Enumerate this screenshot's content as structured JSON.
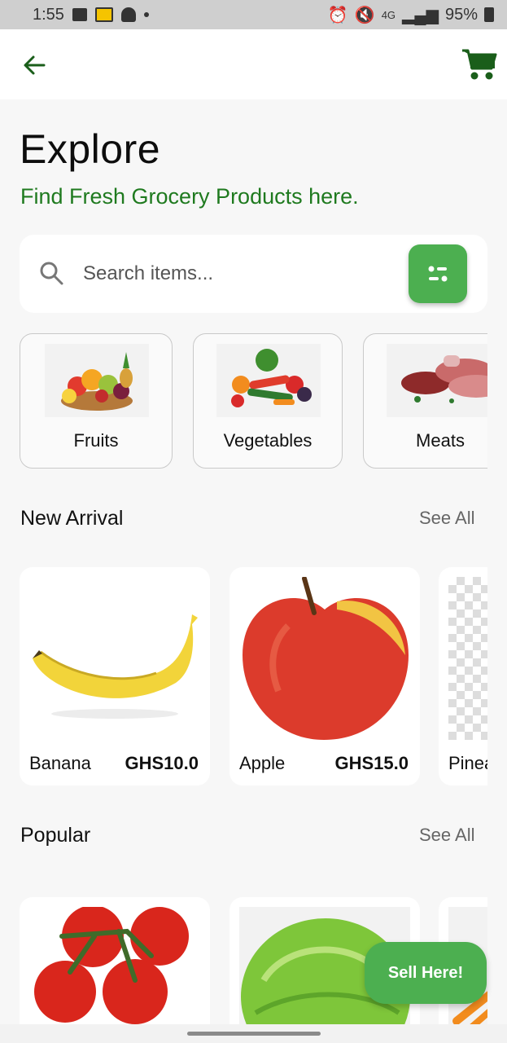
{
  "status_bar": {
    "time": "1:55",
    "network": "4G",
    "battery": "95%"
  },
  "header": {
    "title": "Explore",
    "subtitle": "Find Fresh Grocery Products here."
  },
  "search": {
    "placeholder": "Search items...",
    "value": ""
  },
  "categories": [
    {
      "label": "Fruits"
    },
    {
      "label": "Vegetables"
    },
    {
      "label": "Meats"
    }
  ],
  "new_arrival": {
    "title": "New Arrival",
    "see_all": "See All",
    "items": [
      {
        "name": "Banana",
        "price": "GHS10.0"
      },
      {
        "name": "Apple",
        "price": "GHS15.0"
      },
      {
        "name": "Pinea",
        "price": ""
      }
    ]
  },
  "popular": {
    "title": "Popular",
    "see_all": "See All"
  },
  "fab": {
    "label": "Sell Here!"
  },
  "colors": {
    "accent": "#4caf50",
    "brand_green": "#1f7a1f",
    "background": "#f7f7f7"
  },
  "icons": [
    "back-arrow-icon",
    "cart-icon",
    "search-icon",
    "filter-icon"
  ]
}
